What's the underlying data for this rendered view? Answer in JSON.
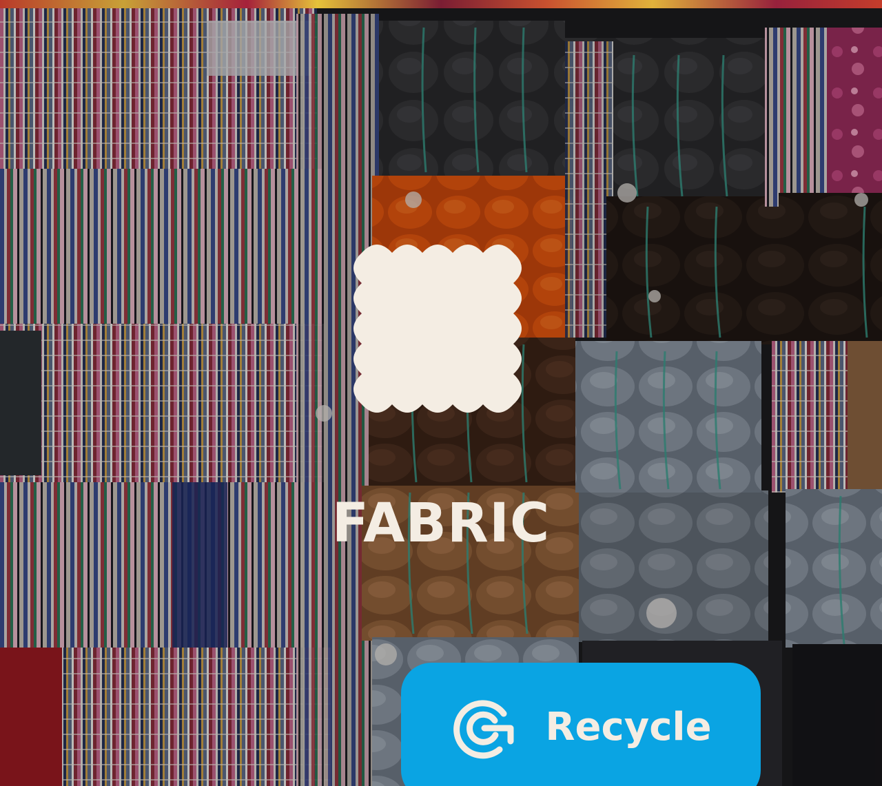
{
  "hero": {
    "title": "FABRIC",
    "icon": "fabric-swatch-icon",
    "photo": "baled-textile-waste"
  },
  "action": {
    "label": "Recycle",
    "icon": "circular-recycle-icon",
    "color": "#0aa4e3"
  },
  "colors": {
    "text": "#f4ede3",
    "overlay_icon": "#f4ede3"
  }
}
